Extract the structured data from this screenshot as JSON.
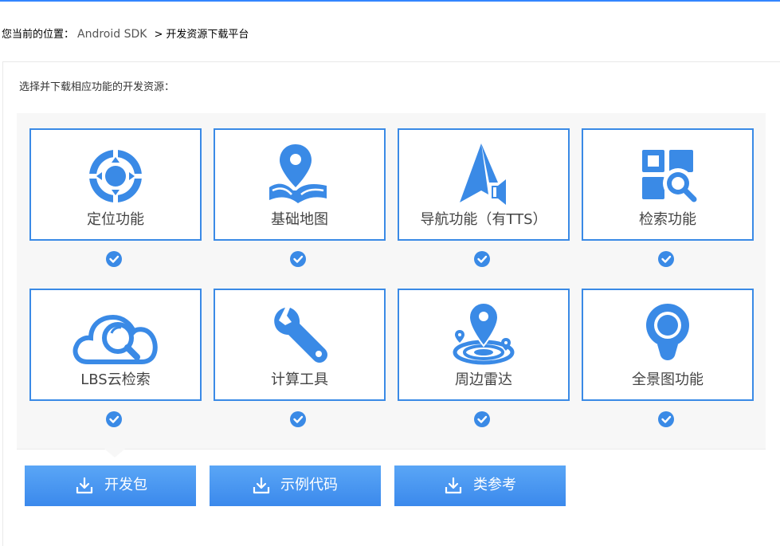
{
  "breadcrumb": {
    "prefix": "您当前的位置：",
    "link": "Android SDK",
    "separator": ">",
    "current": "开发资源下载平台"
  },
  "instruction": "选择并下载相应功能的开发资源：",
  "colors": {
    "accent": "#3a8ae6",
    "card_border": "#3a8ae6",
    "panel_bg": "#f7f7f7",
    "button_top": "#5aa6f6",
    "button_bottom": "#3b89ec"
  },
  "features": [
    {
      "label": "定位功能",
      "icon": "location-target-icon",
      "checked": true
    },
    {
      "label": "基础地图",
      "icon": "map-pin-icon",
      "checked": true
    },
    {
      "label": "导航功能（有TTS）",
      "icon": "navigation-arrow-icon",
      "checked": true
    },
    {
      "label": "检索功能",
      "icon": "search-grid-icon",
      "checked": true
    },
    {
      "label": "LBS云检索",
      "icon": "cloud-search-icon",
      "checked": true
    },
    {
      "label": "计算工具",
      "icon": "wrench-icon",
      "checked": true
    },
    {
      "label": "周边雷达",
      "icon": "radar-pin-icon",
      "checked": true
    },
    {
      "label": "全景图功能",
      "icon": "panorama-icon",
      "checked": true
    }
  ],
  "buttons": [
    {
      "label": "开发包",
      "icon": "download-icon"
    },
    {
      "label": "示例代码",
      "icon": "download-icon"
    },
    {
      "label": "类参考",
      "icon": "download-icon"
    }
  ]
}
